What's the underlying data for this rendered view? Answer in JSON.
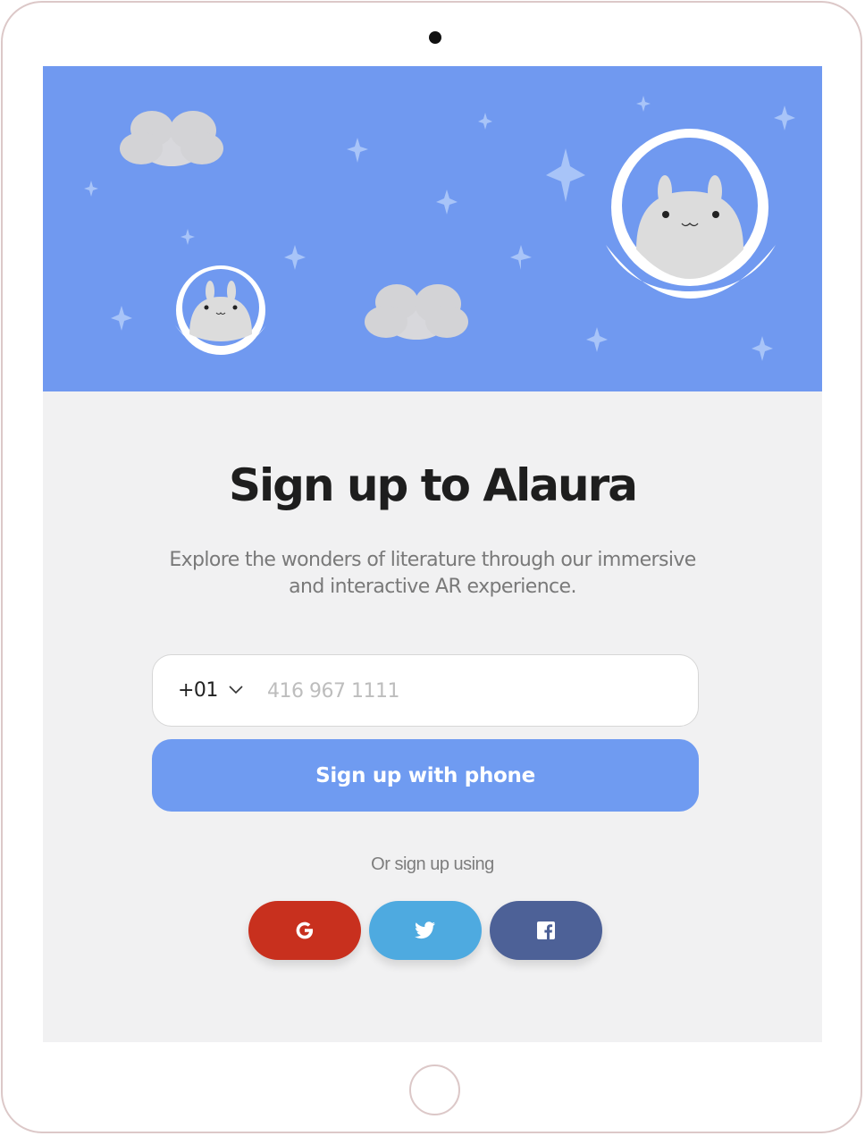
{
  "signup": {
    "title": "Sign up to Alaura",
    "subtitle": "Explore the wonders of literature through our immersive and interactive AR experience.",
    "country_code": "+01",
    "phone_placeholder": "416 967 1111",
    "phone_value": "",
    "submit_label": "Sign up with phone",
    "alt_text": "Or sign up using"
  },
  "social": [
    {
      "name": "google",
      "icon": "google-icon",
      "color": "#c8301e"
    },
    {
      "name": "twitter",
      "icon": "twitter-icon",
      "color": "#4eaae0"
    },
    {
      "name": "facebook",
      "icon": "facebook-icon",
      "color": "#4d6197"
    }
  ],
  "colors": {
    "accent": "#6f9bf1",
    "hero_background": "#7099f0",
    "background": "#f1f1f2"
  },
  "icons": {
    "dropdown": "chevron-down-icon"
  }
}
